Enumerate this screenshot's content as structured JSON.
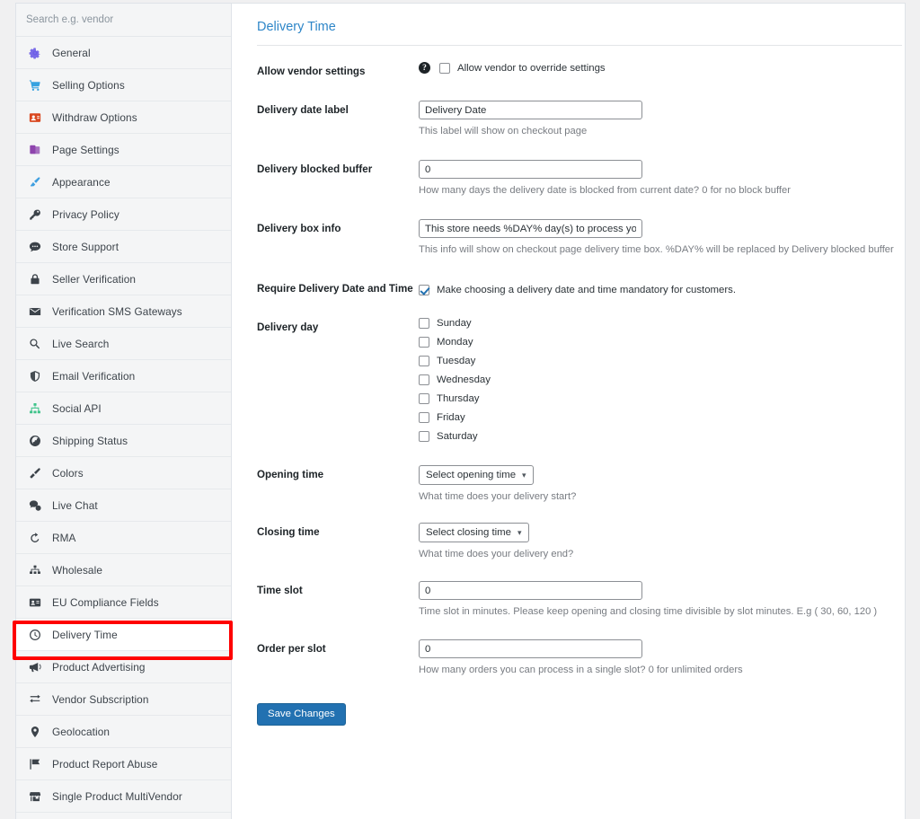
{
  "sidebar": {
    "search": {
      "placeholder": "Search e.g. vendor",
      "value": ""
    },
    "items": [
      {
        "label": "General",
        "icon": "gear-icon",
        "color": "#6c5ce7"
      },
      {
        "label": "Selling Options",
        "icon": "cart-icon",
        "color": "#36a2e0"
      },
      {
        "label": "Withdraw Options",
        "icon": "withdraw-icon",
        "color": "#d9471f"
      },
      {
        "label": "Page Settings",
        "icon": "pages-icon",
        "color": "#8e44ad"
      },
      {
        "label": "Appearance",
        "icon": "brush-icon",
        "color": "#3f9fe0"
      },
      {
        "label": "Privacy Policy",
        "icon": "key-icon",
        "color": "#3c434a"
      },
      {
        "label": "Store Support",
        "icon": "chat-icon",
        "color": "#3c434a"
      },
      {
        "label": "Seller Verification",
        "icon": "lock-icon",
        "color": "#3c434a"
      },
      {
        "label": "Verification SMS Gateways",
        "icon": "envelope-icon",
        "color": "#3c434a"
      },
      {
        "label": "Live Search",
        "icon": "search-icon",
        "color": "#3c434a"
      },
      {
        "label": "Email Verification",
        "icon": "shield-icon",
        "color": "#3c434a"
      },
      {
        "label": "Social API",
        "icon": "sitemap-icon",
        "color": "#3fc38a"
      },
      {
        "label": "Shipping Status",
        "icon": "globe-icon",
        "color": "#3c434a"
      },
      {
        "label": "Colors",
        "icon": "paintbrush-icon",
        "color": "#3c434a"
      },
      {
        "label": "Live Chat",
        "icon": "comments-icon",
        "color": "#3c434a"
      },
      {
        "label": "RMA",
        "icon": "undo-icon",
        "color": "#3c434a"
      },
      {
        "label": "Wholesale",
        "icon": "network-icon",
        "color": "#3c434a"
      },
      {
        "label": "EU Compliance Fields",
        "icon": "idcard-icon",
        "color": "#3c434a"
      },
      {
        "label": "Delivery Time",
        "icon": "clock-icon",
        "color": "#3c434a"
      },
      {
        "label": "Product Advertising",
        "icon": "megaphone-icon",
        "color": "#3c434a"
      },
      {
        "label": "Vendor Subscription",
        "icon": "subscription-icon",
        "color": "#3c434a"
      },
      {
        "label": "Geolocation",
        "icon": "map-pin-icon",
        "color": "#3c434a"
      },
      {
        "label": "Product Report Abuse",
        "icon": "flag-icon",
        "color": "#3c434a"
      },
      {
        "label": "Single Product MultiVendor",
        "icon": "store-icon",
        "color": "#3c434a"
      }
    ],
    "active_index": 18,
    "highlight_color": "#fe0000"
  },
  "panel": {
    "title": "Delivery Time",
    "title_color": "#2e86c8",
    "fields": {
      "allow_vendor_settings": {
        "label": "Allow vendor settings",
        "help_icon": "question-circle-icon",
        "checkbox_label": "Allow vendor to override settings",
        "checked": false
      },
      "delivery_date_label": {
        "label": "Delivery date label",
        "value": "Delivery Date",
        "placeholder": "Delivery Date",
        "help": "This label will show on checkout page"
      },
      "delivery_blocked_buffer": {
        "label": "Delivery blocked buffer",
        "value": "0",
        "placeholder": "0",
        "help": "How many days the delivery date is blocked from current date? 0 for no block buffer"
      },
      "delivery_box_info": {
        "label": "Delivery box info",
        "value": "This store needs %DAY% day(s) to process your de",
        "placeholder": "This store needs %DAY% day(s) to process your delivery",
        "help": "This info will show on checkout page delivery time box. %DAY% will be replaced by Delivery blocked buffer"
      },
      "require_delivery_date_and_time": {
        "label": "Require Delivery Date and Time",
        "checkbox_label": "Make choosing a delivery date and time mandatory for customers.",
        "checked": true
      },
      "delivery_day": {
        "label": "Delivery day",
        "days": [
          {
            "label": "Sunday",
            "checked": false
          },
          {
            "label": "Monday",
            "checked": false
          },
          {
            "label": "Tuesday",
            "checked": false
          },
          {
            "label": "Wednesday",
            "checked": false
          },
          {
            "label": "Thursday",
            "checked": false
          },
          {
            "label": "Friday",
            "checked": false
          },
          {
            "label": "Saturday",
            "checked": false
          }
        ]
      },
      "opening_time": {
        "label": "Opening time",
        "selected": "Select opening time",
        "help": "What time does your delivery start?"
      },
      "closing_time": {
        "label": "Closing time",
        "selected": "Select closing time",
        "help": "What time does your delivery end?"
      },
      "time_slot": {
        "label": "Time slot",
        "value": "0",
        "placeholder": "0",
        "help": "Time slot in minutes. Please keep opening and closing time divisible by slot minutes. E.g ( 30, 60, 120 )"
      },
      "order_per_slot": {
        "label": "Order per slot",
        "value": "0",
        "placeholder": "0",
        "help": "How many orders you can process in a single slot? 0 for unlimited orders"
      }
    },
    "save_button": "Save Changes",
    "save_button_color": "#2271b1"
  }
}
